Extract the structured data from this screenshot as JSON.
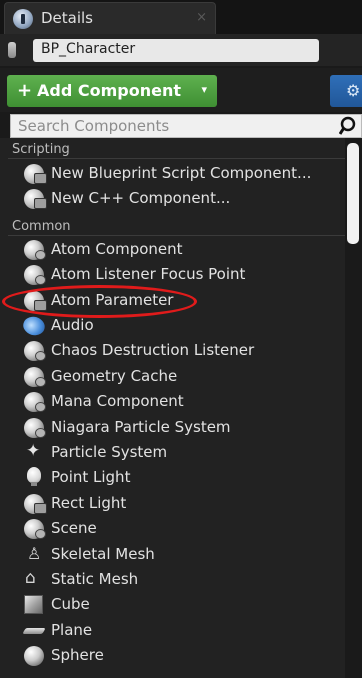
{
  "tab": {
    "title": "Details",
    "close": "×"
  },
  "actor": {
    "name": "BP_Character"
  },
  "toolbar": {
    "add_plus": "+",
    "add_label": "Add Component",
    "add_arrow": "▾",
    "bp_icon": "gear-icon"
  },
  "search": {
    "placeholder": "Search Components"
  },
  "categories": {
    "scripting": "Scripting",
    "common": "Common"
  },
  "items": [
    {
      "label": "New Blueprint Script Component...",
      "icon": "blueprint-component-icon"
    },
    {
      "label": "New C++ Component...",
      "icon": "cpp-component-icon"
    },
    {
      "label": "Atom Component",
      "icon": "atom-component-icon"
    },
    {
      "label": "Atom Listener Focus Point",
      "icon": "atom-listener-icon"
    },
    {
      "label": "Atom Parameter",
      "icon": "atom-parameter-icon"
    },
    {
      "label": "Audio",
      "icon": "audio-icon"
    },
    {
      "label": "Chaos Destruction Listener",
      "icon": "chaos-listener-icon"
    },
    {
      "label": "Geometry Cache",
      "icon": "geometry-cache-icon"
    },
    {
      "label": "Mana Component",
      "icon": "mana-component-icon"
    },
    {
      "label": "Niagara Particle System",
      "icon": "niagara-icon"
    },
    {
      "label": "Particle System",
      "icon": "particle-system-icon"
    },
    {
      "label": "Point Light",
      "icon": "point-light-icon"
    },
    {
      "label": "Rect Light",
      "icon": "rect-light-icon"
    },
    {
      "label": "Scene",
      "icon": "scene-icon"
    },
    {
      "label": "Skeletal Mesh",
      "icon": "skeletal-mesh-icon"
    },
    {
      "label": "Static Mesh",
      "icon": "static-mesh-icon"
    },
    {
      "label": "Cube",
      "icon": "cube-icon"
    },
    {
      "label": "Plane",
      "icon": "plane-icon"
    },
    {
      "label": "Sphere",
      "icon": "sphere-icon"
    }
  ],
  "highlighted_item": "Atom Parameter",
  "colors": {
    "add_button": "#4fa33f",
    "highlight": "#e01b1b",
    "bp_button": "#2f6fb8"
  }
}
